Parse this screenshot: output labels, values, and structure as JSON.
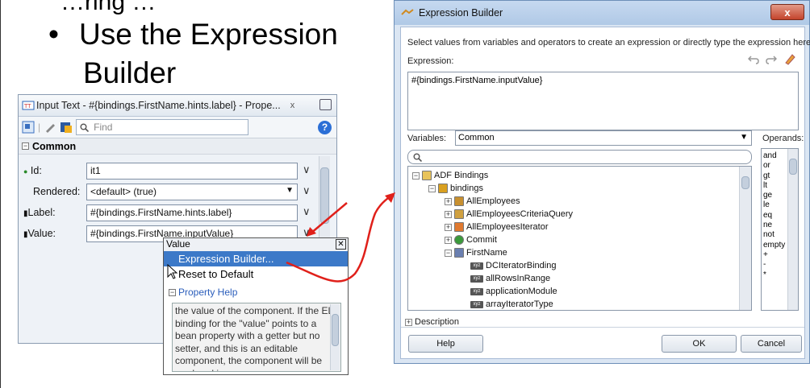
{
  "slide": {
    "top_text": "…ring …",
    "bullet_line1": "Use the Expression",
    "bullet_line2": "Builder"
  },
  "property_inspector": {
    "title": "Input Text - #{bindings.FirstName.hints.label} - Prope...",
    "close": "x",
    "find_placeholder": "Find",
    "section": "Common",
    "rows": [
      {
        "label": "Id:",
        "value": "it1"
      },
      {
        "label": "Rendered:",
        "value": "<default> (true)"
      },
      {
        "label": "Label:",
        "value": "#{bindings.FirstName.hints.label}"
      },
      {
        "label": "Value:",
        "value": "#{bindings.FirstName.inputValue}"
      }
    ]
  },
  "value_menu": {
    "header": "Value",
    "items": [
      "Expression Builder...",
      "Reset to Default"
    ],
    "property_help_title": "Property Help",
    "help_text": "the value of the component. If the EL binding for the \"value\" points to a bean property with a getter but no setter, and this is an editable component, the component will be rendered in"
  },
  "expression_builder": {
    "title": "Expression Builder",
    "instructions": "Select values from variables and operators to create an expression or directly type the expression here:",
    "expression_label": "Expression:",
    "expression_value": "#{bindings.FirstName.inputValue}",
    "variables_label": "Variables:",
    "variables_value": "Common",
    "operands_label": "Operands:",
    "tree": [
      {
        "label": "ADF Bindings",
        "level": 0,
        "icon": "folder-icon",
        "toggle": "−"
      },
      {
        "label": "bindings",
        "level": 1,
        "icon": "bindings-icon",
        "toggle": "−"
      },
      {
        "label": "AllEmployees",
        "level": 2,
        "icon": "tree-binding-icon",
        "toggle": "+"
      },
      {
        "label": "AllEmployeesCriteriaQuery",
        "level": 2,
        "icon": "query-binding-icon",
        "toggle": "+"
      },
      {
        "label": "AllEmployeesIterator",
        "level": 2,
        "icon": "iterator-icon",
        "toggle": "+"
      },
      {
        "label": "Commit",
        "level": 2,
        "icon": "gear-icon",
        "toggle": "+"
      },
      {
        "label": "FirstName",
        "level": 2,
        "icon": "attribute-icon",
        "toggle": "−"
      },
      {
        "label": "DCIteratorBinding",
        "level": 3,
        "icon": "xyz-icon",
        "toggle": ""
      },
      {
        "label": "allRowsInRange",
        "level": 3,
        "icon": "xyz-icon",
        "toggle": ""
      },
      {
        "label": "applicationModule",
        "level": 3,
        "icon": "xyz-icon",
        "toggle": ""
      },
      {
        "label": "arrayIteratorType",
        "level": 3,
        "icon": "xyz-icon",
        "toggle": ""
      }
    ],
    "operands": [
      "and",
      "or",
      "gt",
      "lt",
      "ge",
      "le",
      "eq",
      "ne",
      "not",
      "empty",
      "+",
      "-",
      "*"
    ],
    "description_label": "Description",
    "help_button": "Help",
    "ok_button": "OK",
    "cancel_button": "Cancel"
  },
  "colors": {
    "arrow": "#e0201a",
    "selection": "#3c79c8",
    "dialog_frame": "#dbe6f3"
  }
}
